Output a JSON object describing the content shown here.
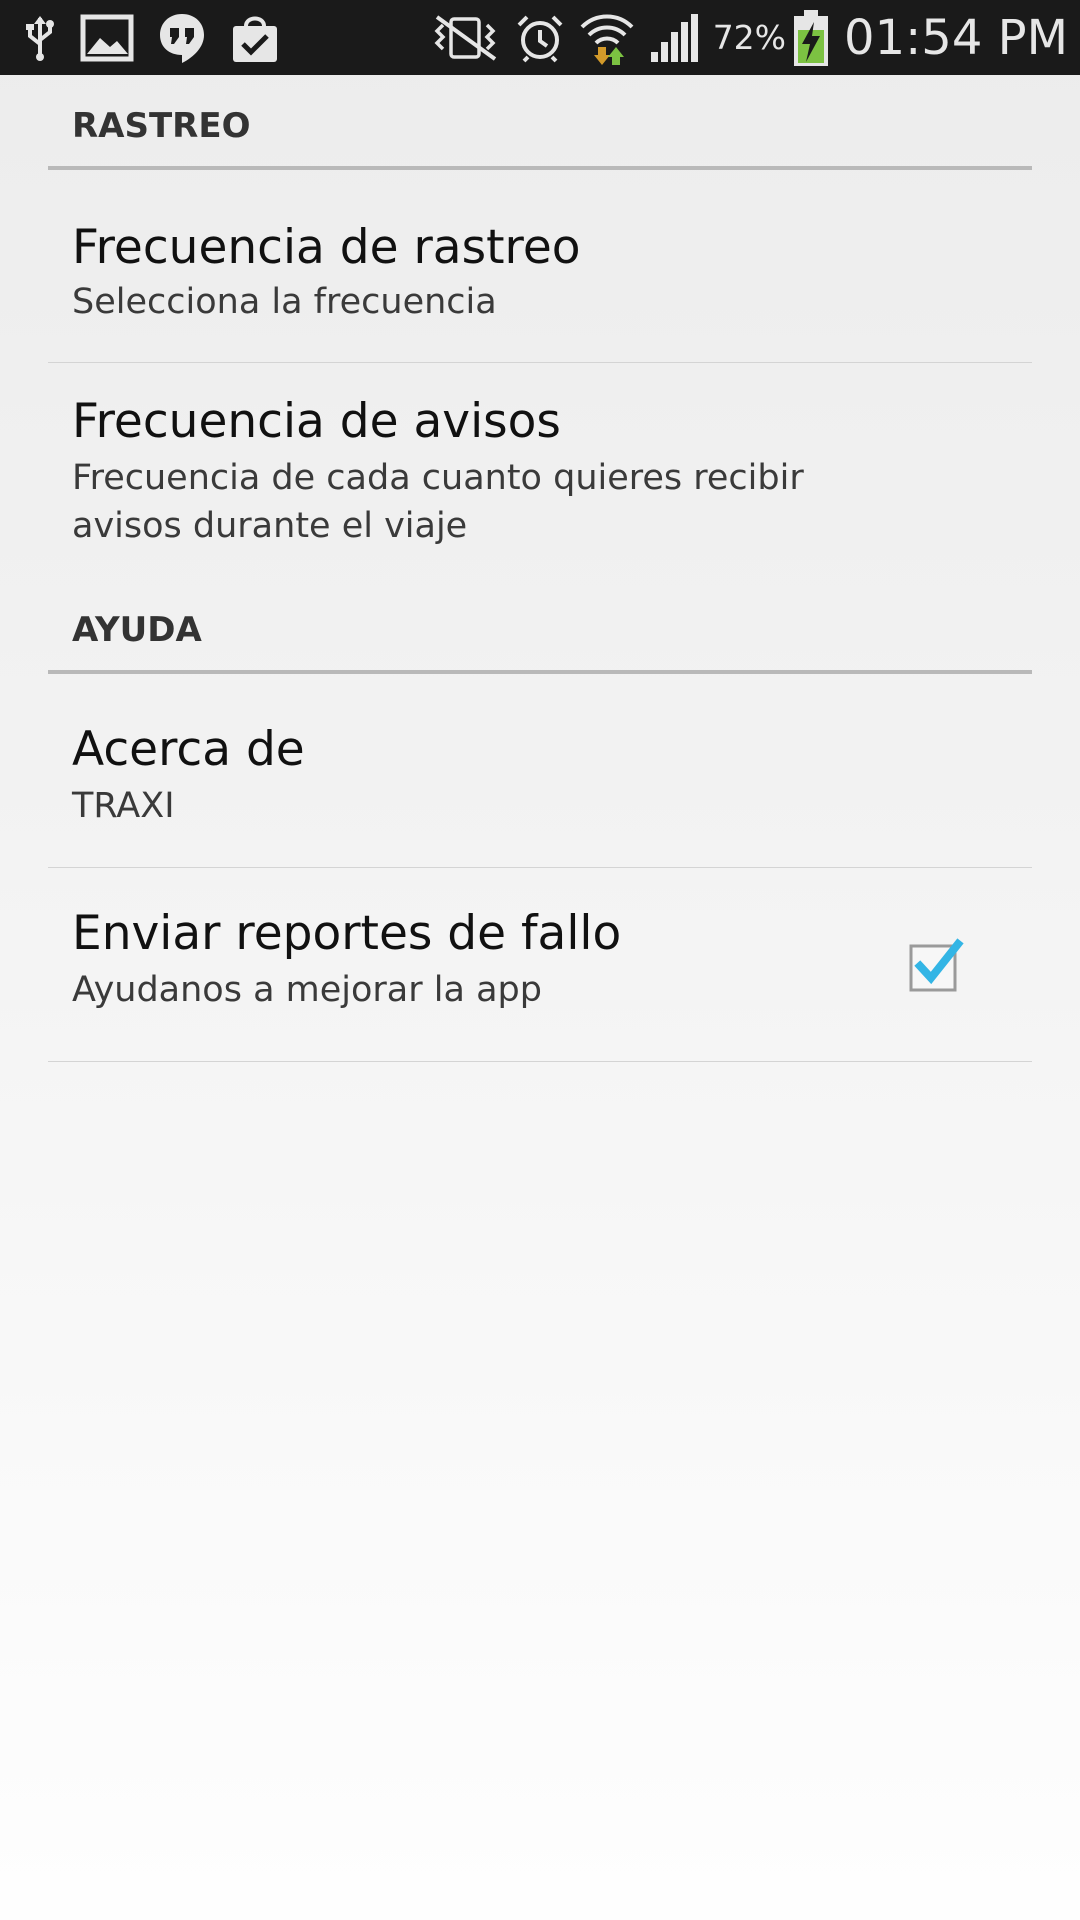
{
  "status_bar": {
    "battery_percent": "72%",
    "time": "01:54 PM",
    "left_icons": [
      "usb-icon",
      "gallery-icon",
      "hangouts-icon",
      "play-store-icon"
    ],
    "right_icons": [
      "vibrate-mute-icon",
      "alarm-icon",
      "wifi-icon",
      "signal-icon",
      "battery-charging-icon"
    ]
  },
  "sections": [
    {
      "title": "RASTREO",
      "items": [
        {
          "title": "Frecuencia de rastreo",
          "summary": "Selecciona la frecuencia"
        },
        {
          "title": "Frecuencia de avisos",
          "summary": "Frecuencia de cada cuanto quieres recibir avisos durante el viaje"
        }
      ]
    },
    {
      "title": "AYUDA",
      "items": [
        {
          "title": "Acerca de",
          "summary": "TRAXI"
        },
        {
          "title": "Enviar reportes de fallo",
          "summary": "Ayudanos a mejorar la app",
          "checked": true
        }
      ]
    }
  ],
  "colors": {
    "status_bar_bg": "#1a1a1a",
    "checkbox_accent": "#33b5e5",
    "battery_green": "#7cc242"
  }
}
